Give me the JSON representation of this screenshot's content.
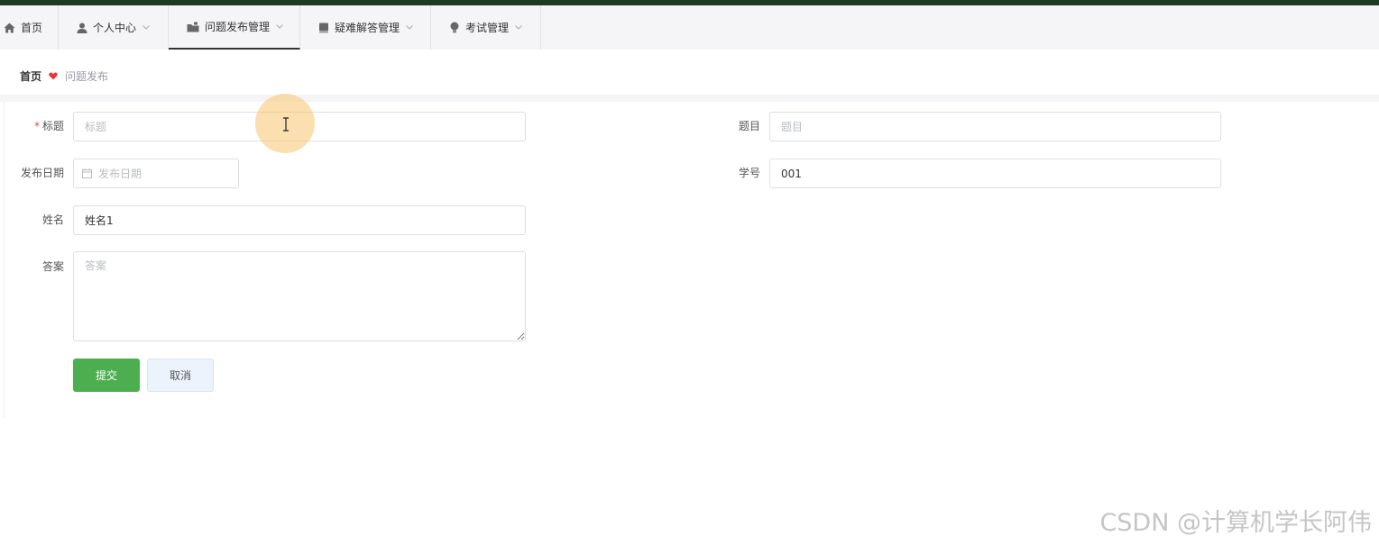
{
  "nav": {
    "items": [
      {
        "label": "首页",
        "icon": "home-icon"
      },
      {
        "label": "个人中心",
        "icon": "user-icon"
      },
      {
        "label": "问题发布管理",
        "icon": "folder-icon"
      },
      {
        "label": "疑难解答管理",
        "icon": "book-icon"
      },
      {
        "label": "考试管理",
        "icon": "bulb-icon"
      }
    ],
    "active_index": 2
  },
  "breadcrumb": {
    "home": "首页",
    "current": "问题发布",
    "separator_icon": "heart-icon",
    "separator_color": "#e4393c"
  },
  "form": {
    "title": {
      "label": "标题",
      "required_mark": "*",
      "placeholder": "标题",
      "value": ""
    },
    "question": {
      "label": "题目",
      "placeholder": "题目",
      "value": ""
    },
    "publish_date": {
      "label": "发布日期",
      "placeholder": "发布日期",
      "value": ""
    },
    "student_id": {
      "label": "学号",
      "placeholder": "学号",
      "value": "001"
    },
    "name": {
      "label": "姓名",
      "placeholder": "姓名",
      "value": "姓名1"
    },
    "answer": {
      "label": "答案",
      "placeholder": "答案",
      "value": ""
    }
  },
  "buttons": {
    "submit": "提交",
    "cancel": "取消"
  },
  "colors": {
    "primary": "#4cae4f",
    "cancel_bg": "#ecf3fd"
  },
  "watermark": "CSDN @计算机学长阿伟"
}
